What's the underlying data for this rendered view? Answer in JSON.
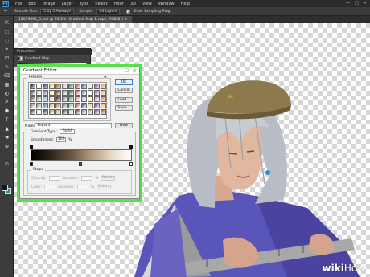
{
  "menubar": {
    "logo": "Ps",
    "items": [
      "File",
      "Edit",
      "Image",
      "Layer",
      "Type",
      "Select",
      "Filter",
      "3D",
      "View",
      "Window",
      "Help"
    ],
    "window_controls": [
      "—",
      "□",
      "×"
    ]
  },
  "options": {
    "sample_size_label": "Sample Size:",
    "sample_size_value": "5 by 5 Average",
    "sample_label": "Sample:",
    "sample_value": "All Layers",
    "show_ring_label": "Show Sampling Ring",
    "show_ring_checked": "✓"
  },
  "document_tab": "12019694_5.psd @ 33.3% (Gradient Map 1 copy, RGB/8*) ×",
  "properties": {
    "title": "Properties",
    "item_label": "Gradient Map"
  },
  "dialog": {
    "title": "Gradient Editor",
    "minimize": "□",
    "close": "×",
    "presets_label": "Presets",
    "presets_gear": "✲",
    "buttons": {
      "ok": "OK",
      "cancel": "Cancel",
      "load": "Load...",
      "save": "Save..."
    },
    "name_label": "Name:",
    "name_value": "Sepia 4",
    "new_button": "New",
    "gradient_type_label": "Gradient Type:",
    "gradient_type_value": "Solid",
    "smoothness_label": "Smoothness:",
    "smoothness_value": "100",
    "smoothness_unit": "%",
    "stops": {
      "legend": "Stops",
      "opacity_label": "Opacity:",
      "color_label": "Color:",
      "location_label": "Location:",
      "percent": "%",
      "delete_label": "Delete"
    },
    "preset_colors": [
      "#000000",
      "#ffffff",
      "#1a1a6e",
      "#e6c35a",
      "#8a5a2a",
      "#c0c0c0",
      "#3e8a3e",
      "#b23a2a",
      "#2f5fa8",
      "#e0e0e0",
      "#7a4a9a",
      "#d89a3a",
      "#2a2a2a",
      "#d0d0d0",
      "#4a6ab8",
      "#f0e68c",
      "#6a3a1a",
      "#9aa0a8",
      "#2a6a3a",
      "#e04a4a",
      "#5a8ad0",
      "#f5f5dc",
      "#a060c0",
      "#f0b040",
      "#505050",
      "#a8a8a8",
      "#8ab0e0",
      "#ffd0a0",
      "#402010",
      "#7890a8",
      "#60a060",
      "#ff8080",
      "#a0c8f0",
      "#fff0d0",
      "#c890e0",
      "#e07830",
      "#787878",
      "#8a8a8a",
      "#3050a0",
      "#c0a070",
      "#a07040",
      "#5a6878",
      "#90c090",
      "#c03030",
      "#204070",
      "#d8c8a8",
      "#603080",
      "#ffa040",
      "#303030",
      "#e8e8e8",
      "#1a3a6a",
      "#b09060",
      "#d0a070",
      "#404858",
      "#b0d8b0",
      "#802020",
      "#6090c0",
      "#b8a080",
      "#8050a0",
      "#c05010"
    ],
    "stop_colors": [
      "#000000",
      "#6f5b45",
      "#ffffff"
    ]
  },
  "tools": [
    "⇱",
    "⬚",
    "◌",
    "⌖",
    "⊡",
    "✎",
    "⌫",
    "▦",
    "◐",
    "✐",
    "⬟",
    "T",
    "▲",
    "☚",
    "⊕",
    "⊙"
  ],
  "watermark": {
    "wiki": "wiki",
    "how": "How"
  }
}
